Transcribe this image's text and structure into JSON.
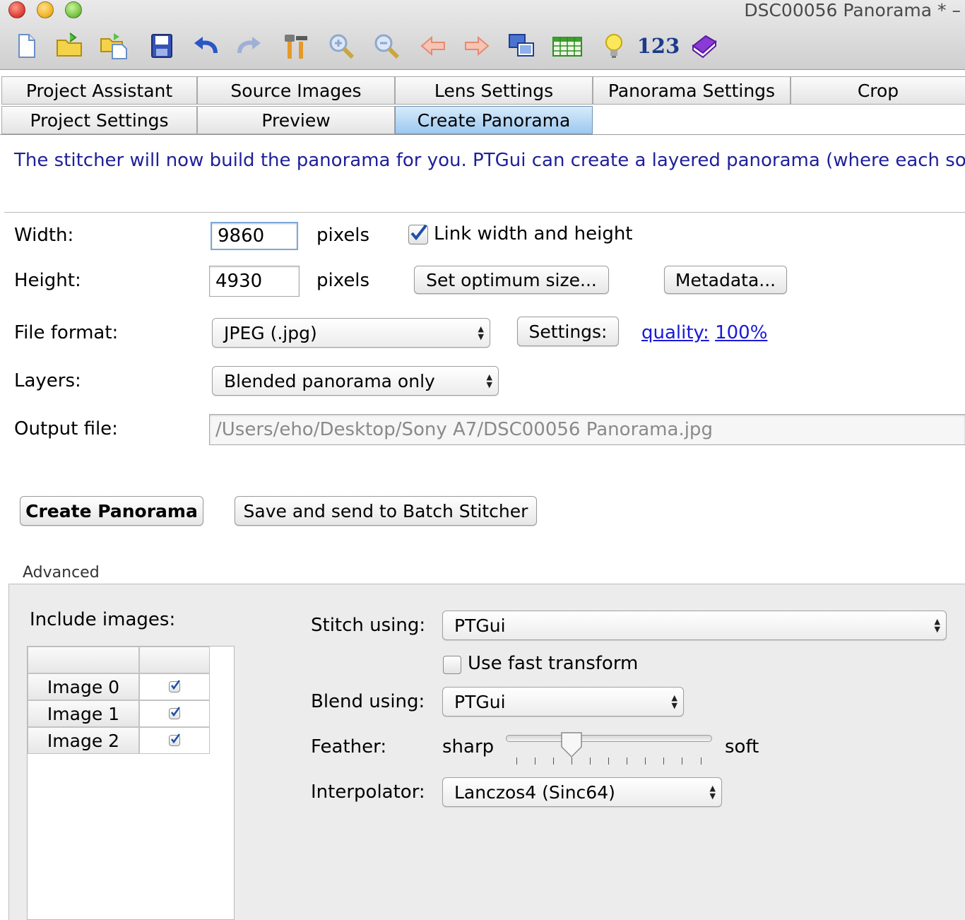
{
  "window": {
    "title": "DSC00056 Panorama * –"
  },
  "toolbar": {
    "items": [
      "new-file-icon",
      "open-folder-icon",
      "open-recent-icon",
      "save-icon",
      "undo-icon",
      "redo-icon",
      "tools-icon",
      "zoom-in-icon",
      "zoom-out-icon",
      "arrow-left-icon",
      "arrow-right-icon",
      "copy-images-icon",
      "spreadsheet-icon",
      "lightbulb-icon",
      "numbers-icon",
      "book-icon"
    ],
    "numbers_label": "123"
  },
  "tabs": {
    "row1": [
      "Project Assistant",
      "Source Images",
      "Lens Settings",
      "Panorama Settings",
      "Crop"
    ],
    "row2": [
      "Project Settings",
      "Preview",
      "Create Panorama"
    ],
    "active": "Create Panorama"
  },
  "description": "The stitcher will now build the panorama for you. PTGui can create a layered panorama (where each source",
  "form": {
    "width_label": "Width:",
    "width_value": "9860",
    "height_label": "Height:",
    "height_value": "4930",
    "pixels_unit": "pixels",
    "link_label": "Link width and height",
    "link_checked": true,
    "set_optimum_label": "Set optimum size...",
    "metadata_label": "Metadata...",
    "file_format_label": "File format:",
    "file_format_value": "JPEG (.jpg)",
    "settings_label": "Settings:",
    "quality_label": "quality:",
    "quality_value": "100%",
    "layers_label": "Layers:",
    "layers_value": "Blended panorama only",
    "output_label": "Output file:",
    "output_value": "/Users/eho/Desktop/Sony A7/DSC00056 Panorama.jpg"
  },
  "actions": {
    "create_label": "Create Panorama",
    "batch_label": "Save and send to Batch Stitcher"
  },
  "advanced": {
    "title": "Advanced",
    "include_label": "Include images:",
    "images": [
      {
        "name": "Image 0",
        "checked": true
      },
      {
        "name": "Image 1",
        "checked": true
      },
      {
        "name": "Image 2",
        "checked": true
      }
    ],
    "stitch_label": "Stitch using:",
    "stitch_value": "PTGui",
    "fast_transform_label": "Use fast transform",
    "fast_transform_checked": false,
    "blend_label": "Blend using:",
    "blend_value": "PTGui",
    "feather_label": "Feather:",
    "feather_min": "sharp",
    "feather_max": "soft",
    "feather_level": 0.3,
    "interpolator_label": "Interpolator:",
    "interpolator_value": "Lanczos4 (Sinc64)"
  },
  "colors": {
    "description_text": "#1f1f9a",
    "link": "#1a1ad6",
    "active_tab": "#9cc8ef"
  }
}
